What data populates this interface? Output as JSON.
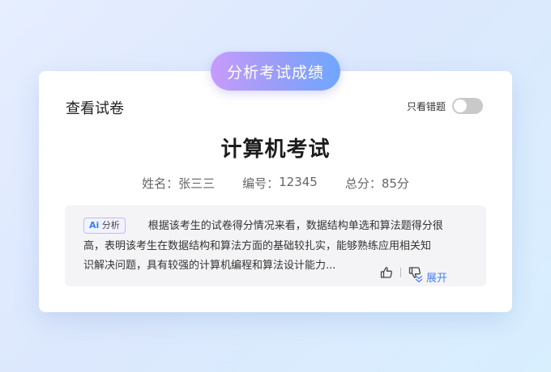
{
  "header_pill": {
    "label": "分析考试成绩"
  },
  "card": {
    "title": "查看试卷",
    "toggle": {
      "label": "只看错题",
      "on": false
    }
  },
  "exam": {
    "title": "计算机考试",
    "info": [
      {
        "label": "姓名：",
        "value": "张三三"
      },
      {
        "label": "编号：",
        "value": "12345"
      },
      {
        "label": "总分：",
        "value": "85分"
      }
    ]
  },
  "ai_analysis": {
    "badge_ai": "Ai",
    "badge_label": "分析",
    "text_lines": [
      "根据该考生的试卷得分情况来看，数据结构单选和算法题得分很",
      "高，表明该考生在数据结构和算法方面的基础较扎实，能够熟练应用相关知",
      "识解决问题，具有较强的计算机编程和算法设计能力..."
    ],
    "expand_label": "展开",
    "icons": {
      "like": "thumbs-up-icon",
      "dislike": "thumbs-down-icon",
      "expand": "double-chevron-down-icon"
    }
  },
  "colors": {
    "pill_gradient_start": "#c79bfb",
    "pill_gradient_end": "#6fa7ff",
    "link_blue": "#4a7ff0",
    "toggle_off": "#c9c9c9"
  }
}
